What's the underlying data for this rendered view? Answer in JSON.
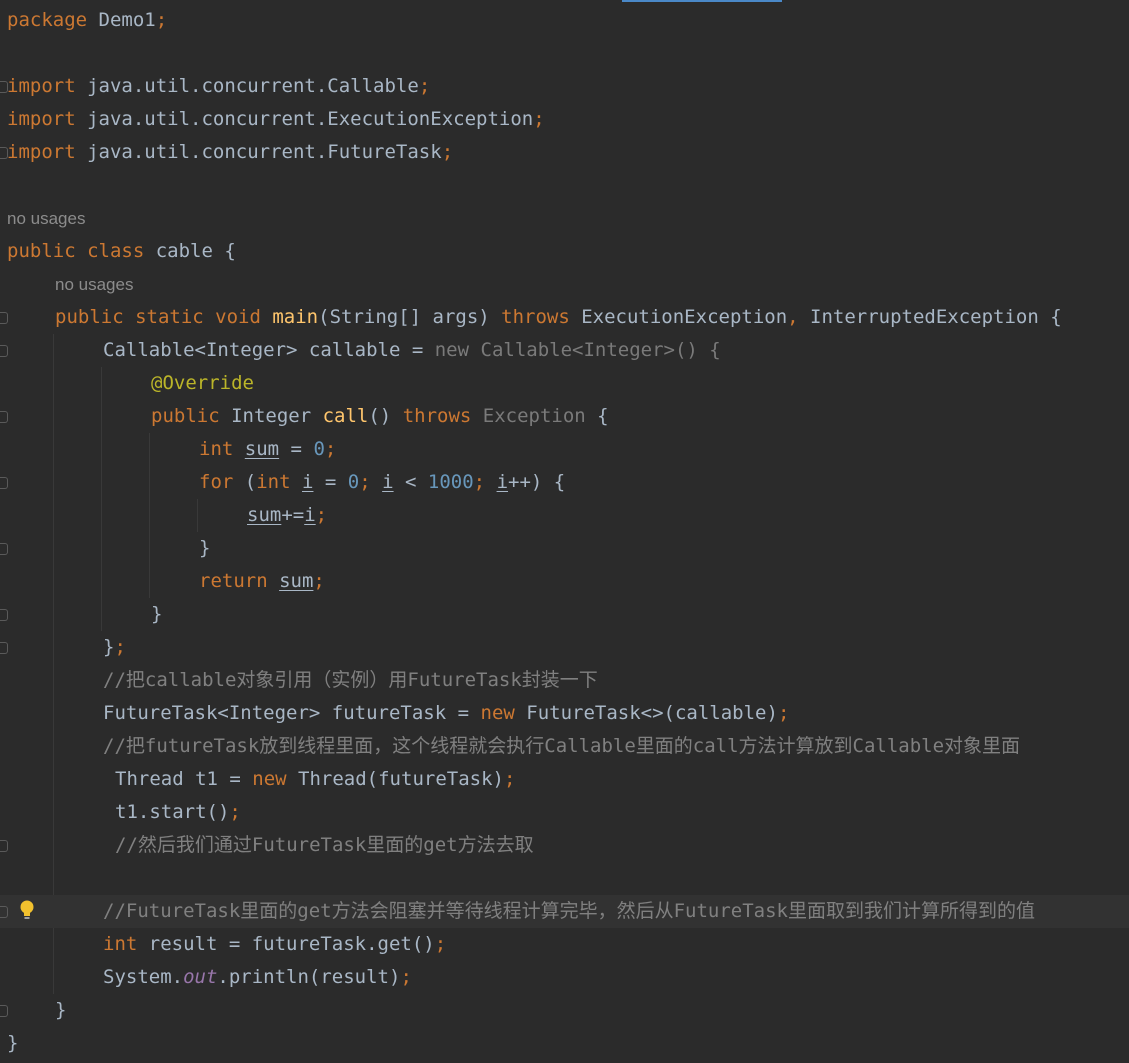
{
  "inlay_hints": {
    "class_usages": "no usages",
    "method_usages": "no usages"
  },
  "code": {
    "package_kw": "package",
    "package_name": " Demo1",
    "semi": ";",
    "import_kw": "import",
    "import1": " java.util.concurrent.Callable",
    "import2": " java.util.concurrent.ExecutionException",
    "import3": " java.util.concurrent.FutureTask",
    "public_kw": "public",
    "class_kw": " class",
    "class_name": " cable {",
    "static_kw": " static",
    "void_kw": " void",
    "main_fn": " main",
    "main_params": "(String[] args)",
    "throws_kw": " throws",
    "exc1": " ExecutionException",
    "comma": ",",
    "exc2": " InterruptedException {",
    "callable_decl": "Callable<Integer> callable = ",
    "new_kw_grey": "new",
    "callable_anon": " Callable<Integer>() {",
    "override": "@Override",
    "integer_type": " Integer ",
    "call_fn": "call",
    "call_parens": "() ",
    "throws_kw_plain": "throws",
    "exception_grey": " Exception",
    "brace_open": " {",
    "int_kw": "int",
    "sum_var": "sum",
    "eq_sp": " = ",
    "zero": "0",
    "for_kw": "for",
    "for_open": " (",
    "i_var": "i",
    "lt": " < ",
    "thousand": "1000",
    "plusplus": "++) {",
    "plus_eq": "+=",
    "close_brace": "}",
    "return_kw": "return",
    "close_brace_semi": "}",
    "comment1": "//把callable对象引用（实例）用FutureTask封装一下",
    "futuretask_decl": "FutureTask<Integer> futureTask = ",
    "new_kw": "new",
    "futuretask_new": " FutureTask<>(callable)",
    "comment2": "//把futureTask放到线程里面，这个线程就会执行Callable里面的call方法计算放到Callable对象里面",
    "thread_decl": "Thread t1 = ",
    "thread_new": " Thread(futureTask)",
    "start_call": "t1.start()",
    "comment3": "//然后我们通过FutureTask里面的get方法去取",
    "comment4": "//FutureTask里面的get方法会阻塞并等待线程计算完毕，然后从FutureTask里面取到我们计算所得到的值",
    "result_decl": " result = futureTask.get()",
    "system": "System.",
    "out_field": "out",
    "println": ".println(result)",
    "space": " ",
    "sum_space": " ",
    "i_eq": " = ",
    "semi_space": "; ",
    "semi_space2": "; "
  },
  "colors": {
    "background": "#2b2b2b",
    "keyword": "#cc7832",
    "number": "#6897bb",
    "function": "#ffc66d",
    "annotation": "#bbb529",
    "comment": "#808080",
    "static_field": "#9876aa",
    "text": "#a9b7c6"
  },
  "icons": {
    "bulb": "lightbulb-icon",
    "fold": "fold-marker-icon"
  }
}
